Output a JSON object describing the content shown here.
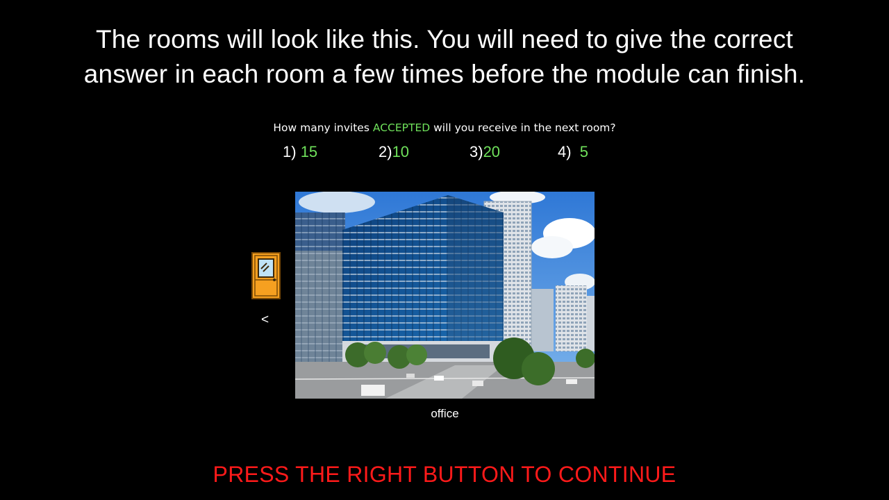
{
  "instructions": {
    "line1": "The rooms will look like this. You will need to give the correct",
    "line2": "answer in each room a few times before the module can finish."
  },
  "question": {
    "prefix": "How many invites ",
    "highlight": "ACCEPTED",
    "suffix": " will you receive in the next room?",
    "options": [
      {
        "number": "1)",
        "value": "15"
      },
      {
        "number": "2)",
        "value": "10"
      },
      {
        "number": "3)",
        "value": "20"
      },
      {
        "number": "4)",
        "value": "5"
      }
    ]
  },
  "navigation": {
    "door_icon": "door-icon",
    "left_arrow": "<"
  },
  "room": {
    "label": "office"
  },
  "footer": {
    "continue_text": "PRESS THE RIGHT BUTTON TO CONTINUE"
  },
  "colors": {
    "background": "#000000",
    "accent_green": "#6fe15b",
    "continue_red": "#ff1a1a",
    "door_orange": "#f6a020"
  }
}
